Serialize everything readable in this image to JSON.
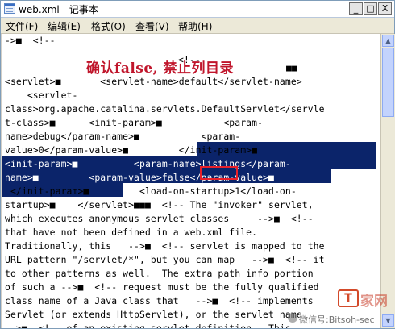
{
  "window": {
    "title": "web.xml - 记事本",
    "controls": {
      "minimize": "_",
      "maximize": "□",
      "close": "X"
    }
  },
  "menu": {
    "items": [
      {
        "label": "文件(F)"
      },
      {
        "label": "编辑(E)"
      },
      {
        "label": "格式(O)"
      },
      {
        "label": "查看(V)"
      },
      {
        "label": "帮助(H)"
      }
    ]
  },
  "editor": {
    "lines": [
      "->■  <!--",
      "",
      "",
      "<servlet>■       <servlet-name>default</servlet-name>",
      "    <servlet-",
      "class>org.apache.catalina.servlets.DefaultServlet</servle",
      "t-class>■      <init-param>■           <param-",
      "name>debug</param-name>■           <param-",
      "value>0</param-value>■         </init-param>■",
      "<init-param>■          <param-name>listings</param-",
      "name>■         <param-value>false</param-value>■",
      " </init-param>■         <load-on-startup>1</load-on-",
      "startup>■    </servlet>■■■  <!-- The \"invoker\" servlet,",
      "which executes anonymous servlet classes     -->■  <!--",
      "that have not been defined in a web.xml file.",
      "Traditionally, this   -->■  <!-- servlet is mapped to the",
      "URL pattern \"/servlet/*\", but you can map   -->■  <!-- it",
      "to other patterns as well.  The extra path info portion",
      "of such a -->■  <!-- request must be the fully qualified",
      "class name of a Java class that   -->■  <!-- implements",
      "Servlet (or extends HttpServlet), or the servlet name",
      "-->■  <!-- of an existing servlet definition.  This"
    ],
    "overlap_fragment": "<!--",
    "overlap_fragment_2": "■■"
  },
  "annotation": {
    "caption": "确认false, 禁止列目录",
    "highlighted_value": "false"
  },
  "watermark": {
    "logo_letter": "T",
    "site_text": "家网",
    "account_text": "微信号:Bitsoh-sec"
  }
}
